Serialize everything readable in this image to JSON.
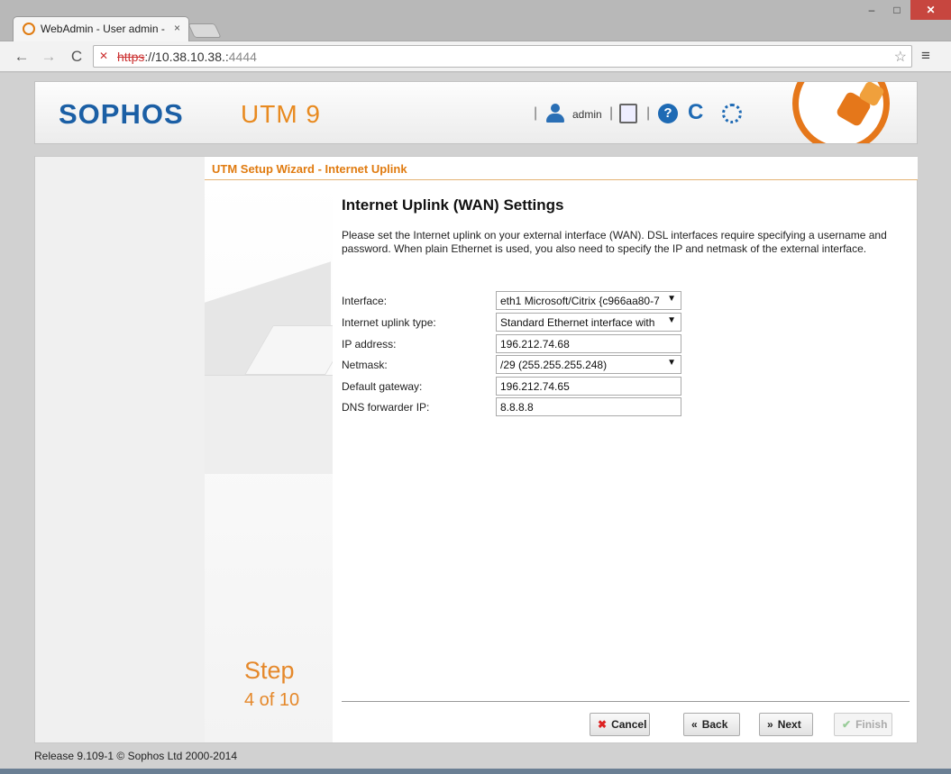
{
  "browser": {
    "tab_title": "WebAdmin - User admin -",
    "tab_close": "×",
    "window_min": "–",
    "window_max": "□",
    "window_close": "✕",
    "nav_back": "←",
    "nav_forward": "→",
    "nav_reload": "C",
    "url_scheme": "https",
    "url_host": "://10.38.10.38.:",
    "url_port": "4444",
    "star": "☆",
    "menu": "≡"
  },
  "header": {
    "logo": "SOPHOS",
    "product": "UTM 9",
    "separator": "|",
    "user": "admin",
    "help": "?",
    "refresh": "C"
  },
  "wizard": {
    "title": "UTM Setup Wizard - Internet Uplink",
    "step_word": "Step",
    "step_count": "4 of 10",
    "heading": "Internet Uplink (WAN) Settings",
    "description": "Please set the Internet uplink on your external interface (WAN). DSL interfaces require specifying a username and password. When plain Ethernet is used, you also need to specify the IP and netmask of the external interface.",
    "fields": {
      "interface": {
        "label": "Interface:",
        "value": "eth1 Microsoft/Citrix {c966aa80-7"
      },
      "uplink_type": {
        "label": "Internet uplink type:",
        "value": "Standard Ethernet interface with"
      },
      "ip_address": {
        "label": "IP address:",
        "value": "196.212.74.68"
      },
      "netmask": {
        "label": "Netmask:",
        "value": "/29 (255.255.255.248)"
      },
      "gateway": {
        "label": "Default gateway:",
        "value": "196.212.74.65"
      },
      "dns": {
        "label": "DNS forwarder IP:",
        "value": "8.8.8.8"
      }
    },
    "dropdown_arrow": "▼",
    "buttons": {
      "cancel": "Cancel",
      "cancel_icon": "✖",
      "back": "Back",
      "back_icon": "«",
      "next": "Next",
      "next_icon": "»",
      "finish": "Finish",
      "finish_icon": "✔"
    }
  },
  "footer": {
    "release": "Release 9.109-1 © Sophos Ltd 2000-2014"
  },
  "colors": {
    "brand_blue": "#1b5fa5",
    "brand_orange": "#e5771a"
  }
}
